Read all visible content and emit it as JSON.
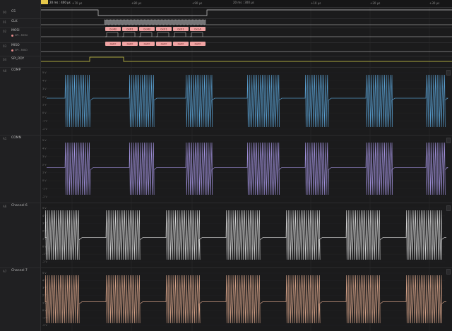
{
  "ruler": {
    "marker_label": "20 ms : 400 µs",
    "center_label": "20 ms : 300 µs",
    "ticks": [
      "+70 µs",
      "+80 µs",
      "+90 µs",
      "+10 µs",
      "+20 µs",
      "+30 µs"
    ]
  },
  "channels": [
    {
      "id": "00",
      "name": "CS"
    },
    {
      "id": "01",
      "name": "CLK"
    },
    {
      "id": "02",
      "name": "MOSI",
      "sub": "SPI - MOSI"
    },
    {
      "id": "03",
      "name": "MISO",
      "sub": "SPI - MISO"
    },
    {
      "id": "04",
      "name": "SPI_RDY"
    },
    {
      "id": "A0",
      "name": "COMP"
    },
    {
      "id": "A1",
      "name": "COMN"
    },
    {
      "id": "A6",
      "name": "Channel 6"
    },
    {
      "id": "A7",
      "name": "Channel 7"
    }
  ],
  "mosi_bytes": [
    "0x4B",
    "0x61",
    "0x4B",
    "0x01",
    "0x01",
    "0x1A"
  ],
  "miso_bytes": [
    "0xFF",
    "0xFF",
    "0xFF",
    "0xFF",
    "0xFF",
    "0xFF"
  ],
  "analog_scale": [
    "5 V",
    "4 V",
    "3 V",
    "2 V",
    "1 V",
    "0 V",
    "-1 V",
    "-2 V"
  ],
  "colors": {
    "comp": "#5ba3d6",
    "comn": "#a595e3",
    "ch6": "#d8d8d8",
    "ch7": "#d9a58a",
    "digital": "#cfcfcf",
    "decode": "#f0a3a3",
    "rdy": "#d9d44a"
  }
}
